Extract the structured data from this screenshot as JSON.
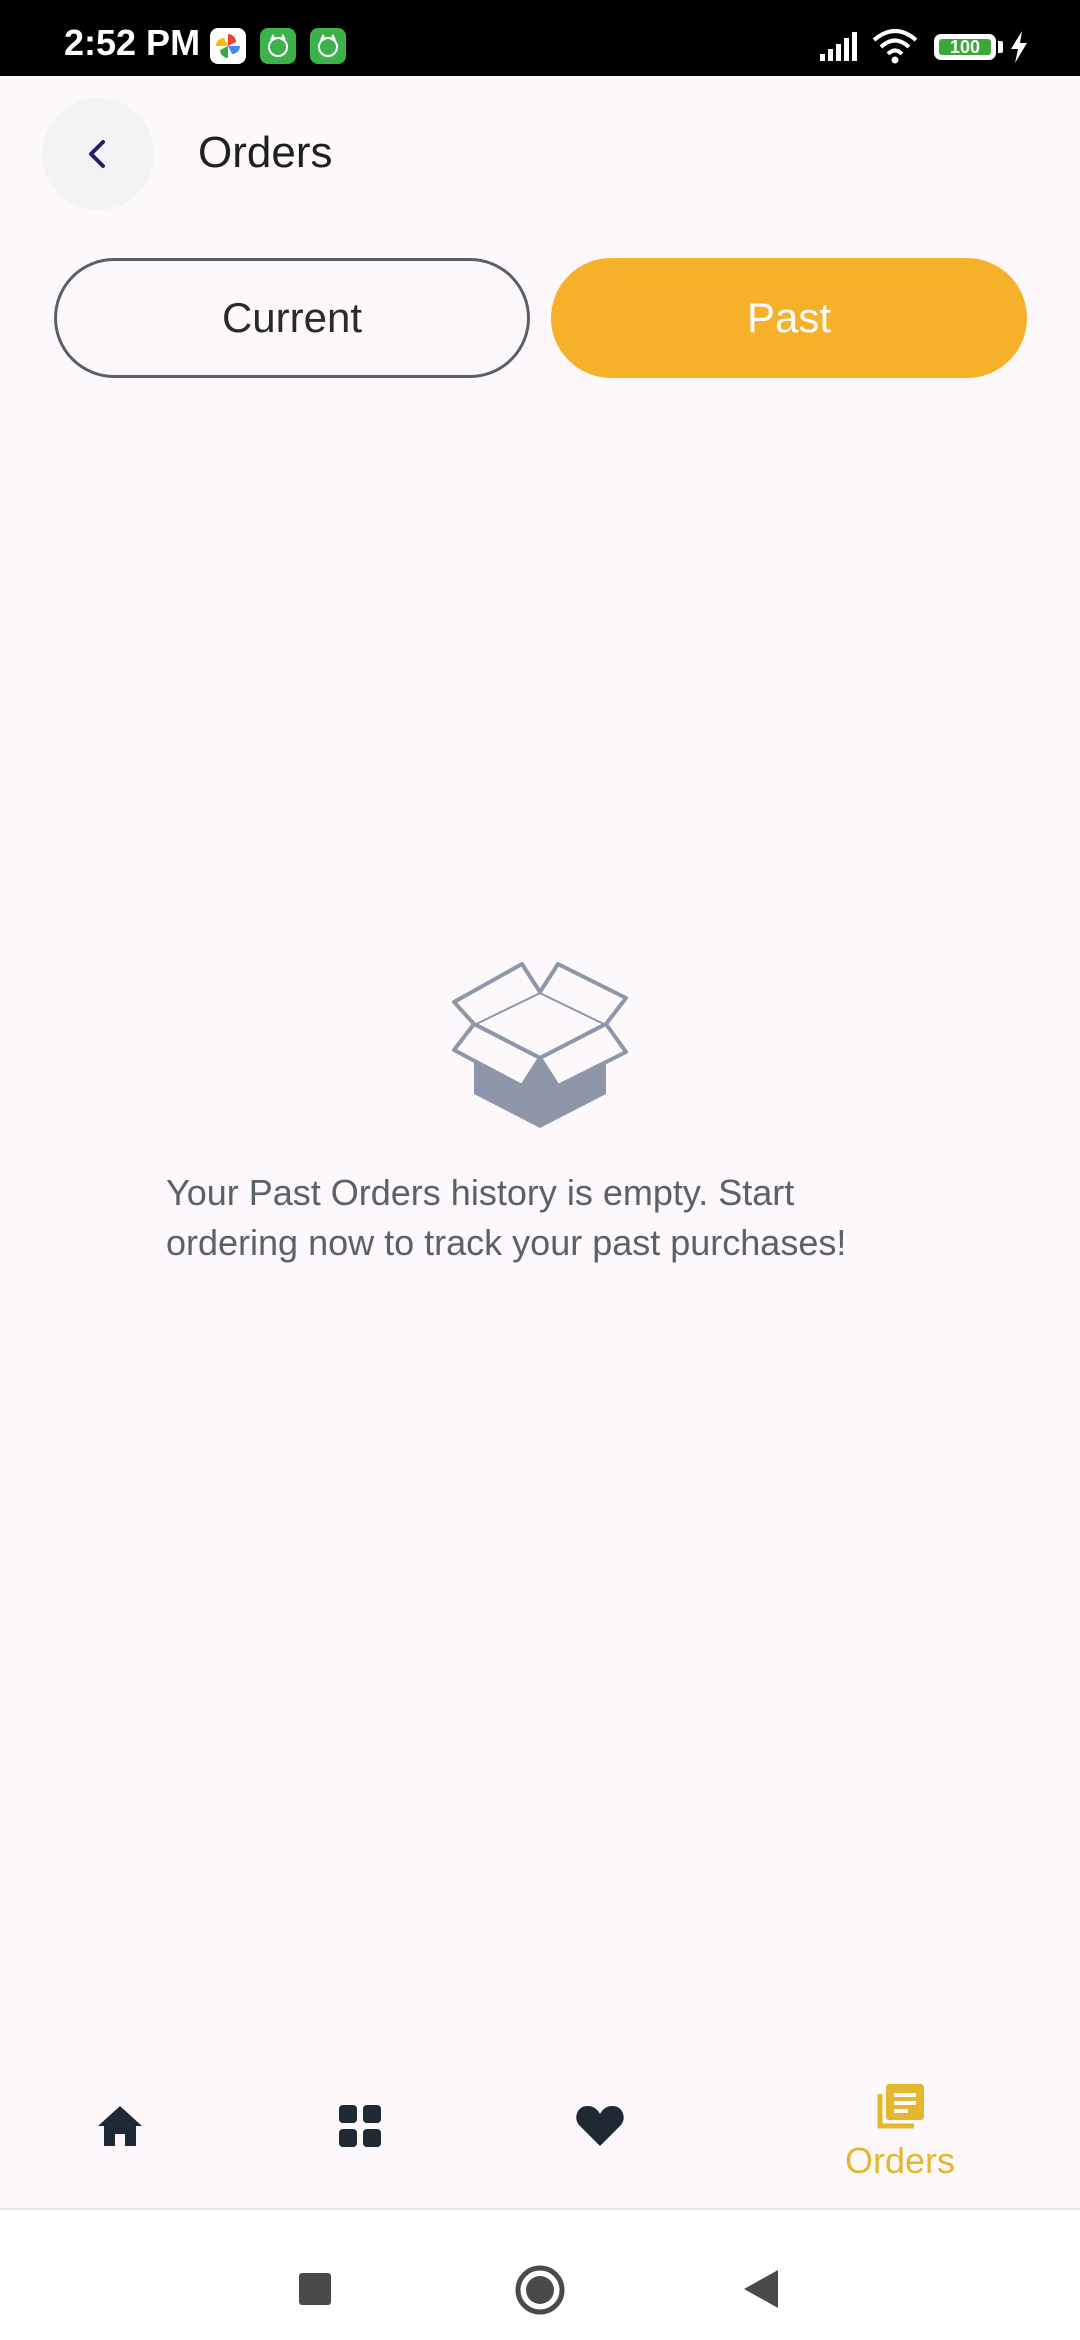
{
  "status_bar": {
    "time": "2:52 PM",
    "battery": "100"
  },
  "header": {
    "title": "Orders"
  },
  "tabs": [
    {
      "label": "Current"
    },
    {
      "label": "Past"
    }
  ],
  "empty_state": {
    "message": "Your Past Orders history is empty. Start ordering now to track your past purchases!"
  },
  "bottom_nav": {
    "items": [
      {
        "icon": "home-icon"
      },
      {
        "icon": "grid-icon"
      },
      {
        "icon": "heart-icon"
      },
      {
        "icon": "orders-icon",
        "label": "Orders"
      }
    ]
  },
  "colors": {
    "accent": "#f7b029",
    "orders_active": "#e5b72c",
    "background": "#fdf8fb"
  }
}
